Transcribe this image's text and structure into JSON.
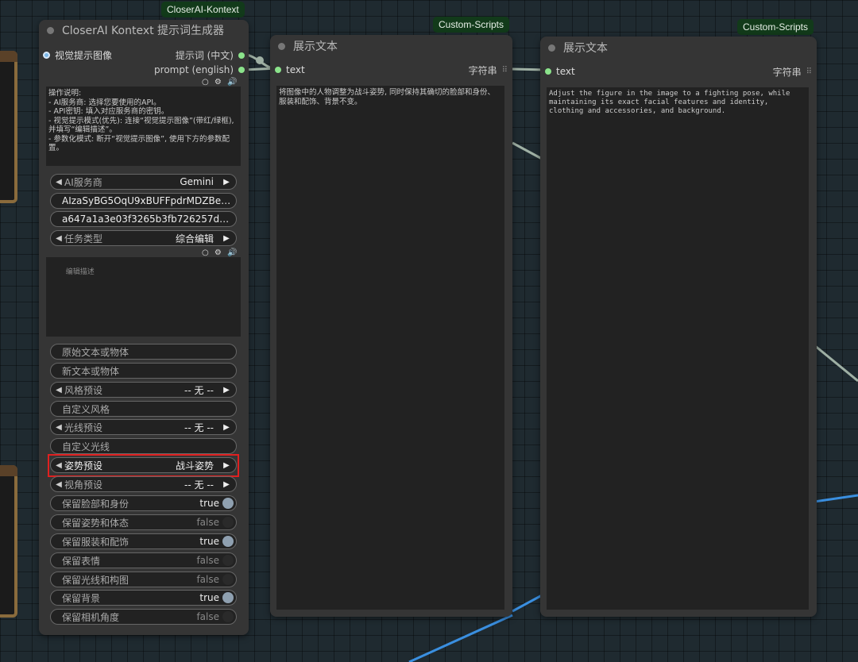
{
  "nodes": {
    "prompt_gen": {
      "badge": "CloserAI-Kontext",
      "title": "CloserAI Kontext 提示词生成器",
      "input_visual": "视觉提示图像",
      "output_cn": "提示词 (中文)",
      "output_en": "prompt (english)",
      "instructions": "操作说明:\n- AI服务商: 选择您要使用的API。\n- API密钥: 填入对应服务商的密钥。\n- 视觉提示模式(优先): 连接“视觉提示图像”(带红/绿框), 并填写“编辑描述”。\n- 参数化模式: 断开“视觉提示图像”, 使用下方的参数配置。",
      "edit_placeholder": "编辑描述",
      "icons": "○ ⚙ 🔊",
      "combos": {
        "ai_provider": {
          "label": "AI服务商",
          "value": "Gemini"
        },
        "task_type": {
          "label": "任务类型",
          "value": "综合编辑"
        },
        "style_preset": {
          "label": "风格预设",
          "value": "-- 无 --"
        },
        "light_preset": {
          "label": "光线预设",
          "value": "-- 无 --"
        },
        "pose_preset": {
          "label": "姿势预设",
          "value": "战斗姿势"
        },
        "view_preset": {
          "label": "视角预设",
          "value": "-- 无 --"
        }
      },
      "api_key": "AIzaSyBG5OqU9xBUFFpdrMDZBeL...",
      "secret": "a647a1a3e03f3265b3fb726257db2e ...",
      "text_fields": {
        "orig_text": "原始文本或物体",
        "new_text": "新文本或物体",
        "custom_style": "自定义风格",
        "custom_light": "自定义光线"
      },
      "toggles": {
        "keep_face": {
          "label": "保留脸部和身份",
          "value": "true"
        },
        "keep_pose": {
          "label": "保留姿势和体态",
          "value": "false"
        },
        "keep_outfit": {
          "label": "保留服装和配饰",
          "value": "true"
        },
        "keep_expr": {
          "label": "保留表情",
          "value": "false"
        },
        "keep_light": {
          "label": "保留光线和构图",
          "value": "false"
        },
        "keep_bg": {
          "label": "保留背景",
          "value": "true"
        },
        "keep_cam": {
          "label": "保留相机角度",
          "value": "false"
        }
      }
    },
    "show1": {
      "badge": "Custom-Scripts",
      "title": "展示文本",
      "input": "text",
      "output": "字符串",
      "content": "将图像中的人物调整为战斗姿势, 同时保持其确切的脸部和身份、服装和配饰、背景不变。"
    },
    "show2": {
      "badge": "Custom-Scripts",
      "title": "展示文本",
      "input": "text",
      "output": "字符串",
      "content": "Adjust the figure in the image to a fighting pose, while maintaining its exact facial features and identity, clothing and accessories, and background."
    }
  },
  "colors": {
    "canvas": "#1f2a30",
    "node_bg": "#353535",
    "badge_bg": "#123a1a",
    "slot_green": "#8be38b",
    "wire_blue": "#3a8fe0",
    "highlight": "#e02020"
  }
}
